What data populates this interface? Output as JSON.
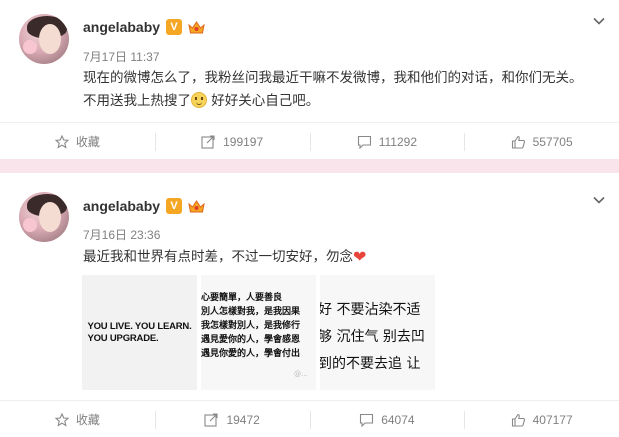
{
  "posts": [
    {
      "user": "angelababy",
      "verified_badge": "V",
      "time": "7月17日 11:37",
      "text_a": "现在的微博怎么了，我粉丝问我最近干嘛不发微博，我和他们的对话，和你们无关。不用送我上热搜了",
      "text_b": " 好好关心自己吧。",
      "emoji_icon": "smile-emoji-icon",
      "actions": {
        "favorite": "收藏",
        "repost": "199197",
        "comment": "111292",
        "like": "557705"
      }
    },
    {
      "user": "angelababy",
      "verified_badge": "V",
      "time": "7月16日 23:36",
      "text_a": "最近我和世界有点时差，不过一切安好，勿念",
      "heart": "❤",
      "images": [
        {
          "lines": [
            "YOU LIVE. YOU LEARN.",
            "YOU UPGRADE."
          ]
        },
        {
          "lines": [
            "心要簡單，人要善良",
            "別人怎樣對我，是我因果",
            "我怎樣對別人，是我修行",
            "遇見愛你的人，學會感恩",
            "遇見你愛的人，學會付出"
          ],
          "watermark": "@…"
        },
        {
          "lines": [
            "好 不要沾染不适",
            "够 沉住气 别去凹",
            "到的不要去追 让"
          ]
        }
      ],
      "actions": {
        "favorite": "收藏",
        "repost": "19472",
        "comment": "64074",
        "like": "407177"
      }
    }
  ],
  "colors": {
    "accent_band": "#f8e4ea",
    "meta": "#808080",
    "heart": "#e8443a",
    "badge": "#f5a623"
  }
}
